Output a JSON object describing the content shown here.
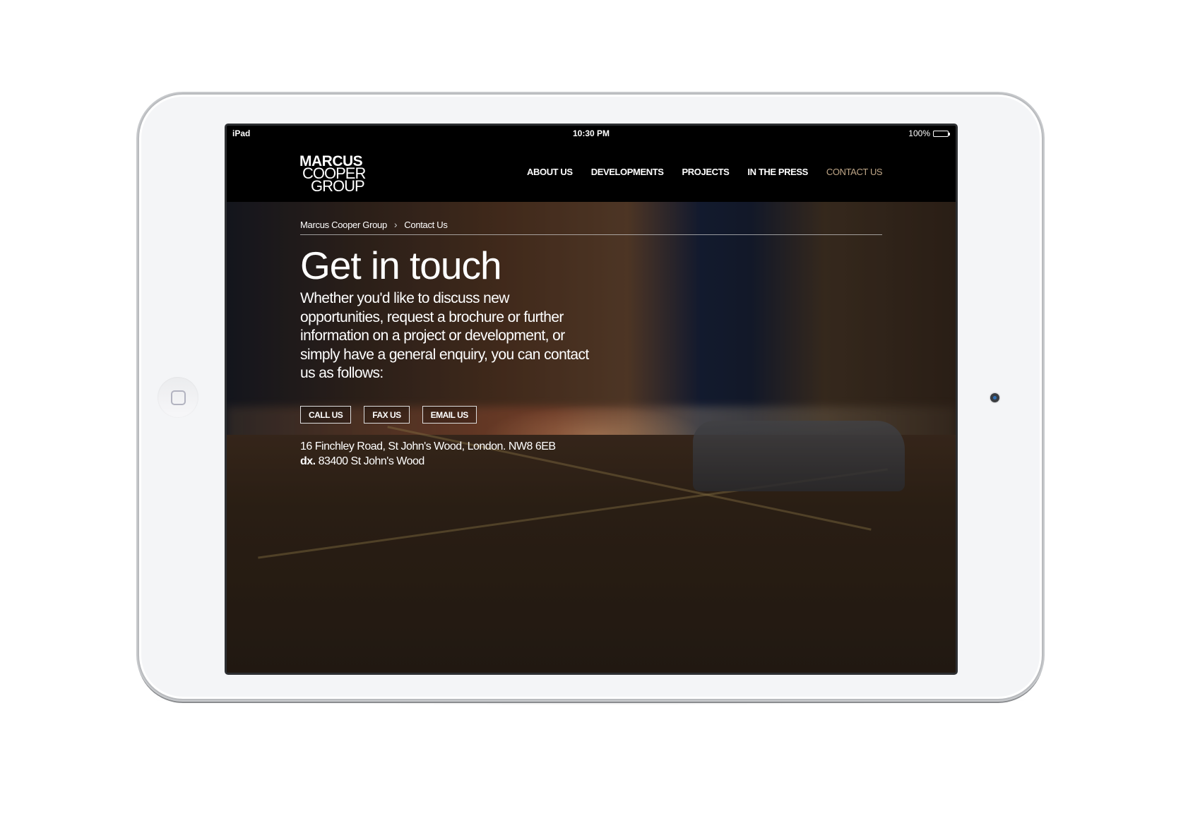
{
  "device": {
    "status_bar": {
      "device_name": "iPad",
      "time": "10:30 PM",
      "battery_percent": "100%",
      "battery_level": 1.0
    }
  },
  "site": {
    "logo": {
      "line1": "MARCUS",
      "line2": "COOPER",
      "line3": "GROUP"
    },
    "nav": [
      {
        "label": "ABOUT US",
        "active": false
      },
      {
        "label": "DEVELOPMENTS",
        "active": false
      },
      {
        "label": "PROJECTS",
        "active": false
      },
      {
        "label": "IN THE PRESS",
        "active": false
      },
      {
        "label": "CONTACT US",
        "active": true
      }
    ],
    "active_color": "#c0a788"
  },
  "page": {
    "breadcrumb": {
      "home": "Marcus Cooper Group",
      "separator": ">",
      "current": "Contact Us"
    },
    "title": "Get in touch",
    "intro": "Whether you'd like to discuss new opportunities, request a brochure or further information on a project or development, or simply have a general enquiry, you can contact us as follows:",
    "buttons": {
      "call": "CALL US",
      "fax": "FAX US",
      "email": "EMAIL US"
    },
    "address": {
      "line": "16 Finchley Road, St John's Wood, London. NW8 6EB",
      "dx_label": "dx.",
      "dx_value": "83400 St John's Wood"
    }
  }
}
